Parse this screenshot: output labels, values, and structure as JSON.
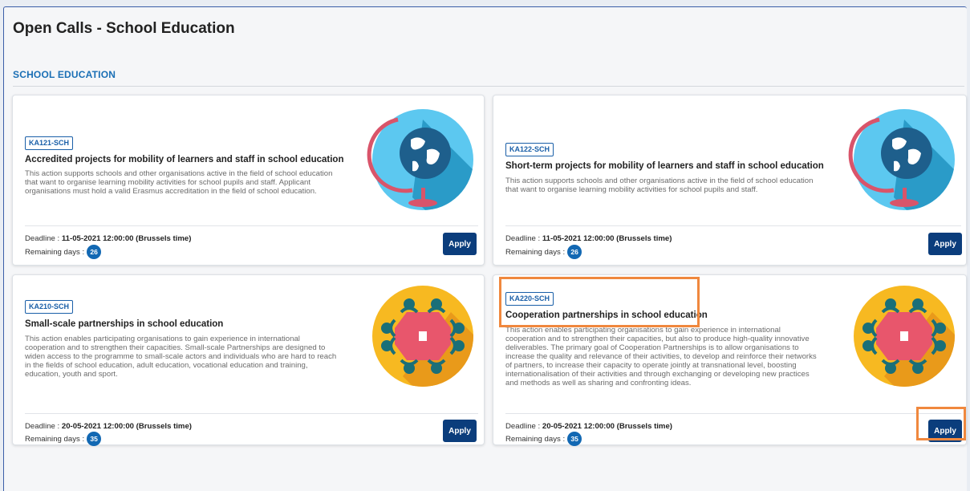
{
  "page": {
    "title": "Open Calls - School Education"
  },
  "section": {
    "title": "SCHOOL EDUCATION"
  },
  "cards": [
    {
      "code": "KA121-SCH",
      "title": "Accredited projects for mobility of learners and staff in school education",
      "desc_lines": [
        "This action supports schools and other organisations active in the field of school education",
        "that want to organise learning mobility activities for school pupils and staff. Applicant",
        "organisations must hold a valid Erasmus accreditation in the field of school education."
      ],
      "deadline_label": "Deadline : ",
      "deadline": "11-05-2021 12:00:00 (Brussels time)",
      "remaining_label": "Remaining days : ",
      "remaining": "26",
      "apply_label": "Apply",
      "illustration": "globe-icon"
    },
    {
      "code": "KA122-SCH",
      "title": "Short-term projects for mobility of learners and staff in school education",
      "desc_lines": [
        "This action supports schools and other organisations active in the field of school education",
        "that want to organise learning mobility activities for school pupils and staff."
      ],
      "deadline_label": "Deadline : ",
      "deadline": "11-05-2021 12:00:00 (Brussels time)",
      "remaining_label": "Remaining days : ",
      "remaining": "26",
      "apply_label": "Apply",
      "illustration": "globe-icon"
    },
    {
      "code": "KA210-SCH",
      "title": "Small-scale partnerships in school education",
      "desc_lines": [
        "This action enables participating organisations to gain experience in international",
        "cooperation and to strengthen their capacities. Small-scale Partnerships are designed to",
        "widen access to the programme to small-scale actors and individuals who are hard to reach",
        "in the fields of school education, adult education, vocational education and training,",
        "education, youth and sport."
      ],
      "deadline_label": "Deadline : ",
      "deadline": "20-05-2021 12:00:00 (Brussels time)",
      "remaining_label": "Remaining days : ",
      "remaining": "35",
      "apply_label": "Apply",
      "illustration": "meeting-table-icon"
    },
    {
      "code": "KA220-SCH",
      "title": "Cooperation partnerships in school education",
      "desc_lines": [
        "This action enables participating organisations to gain experience in international",
        "cooperation and to strengthen their capacities, but also to produce high-quality innovative",
        "deliverables. The primary goal of Cooperation Partnerships is to allow organisations to",
        "increase the quality and relevance of their activities, to develop and reinforce their networks",
        "of partners, to increase their capacity to operate jointly at transnational level, boosting",
        "internationalisation of their activities and through exchanging or developing new practices",
        "and methods as well as sharing and confronting ideas."
      ],
      "deadline_label": "Deadline : ",
      "deadline": "20-05-2021 12:00:00 (Brussels time)",
      "remaining_label": "Remaining days : ",
      "remaining": "35",
      "apply_label": "Apply",
      "illustration": "meeting-table-icon"
    }
  ],
  "colors": {
    "accent": "#1a6fb5",
    "apply_button": "#0b3d7c",
    "highlight": "#f0883e",
    "globe_bg": "#5cc8f0",
    "meeting_bg": "#f7b921"
  }
}
